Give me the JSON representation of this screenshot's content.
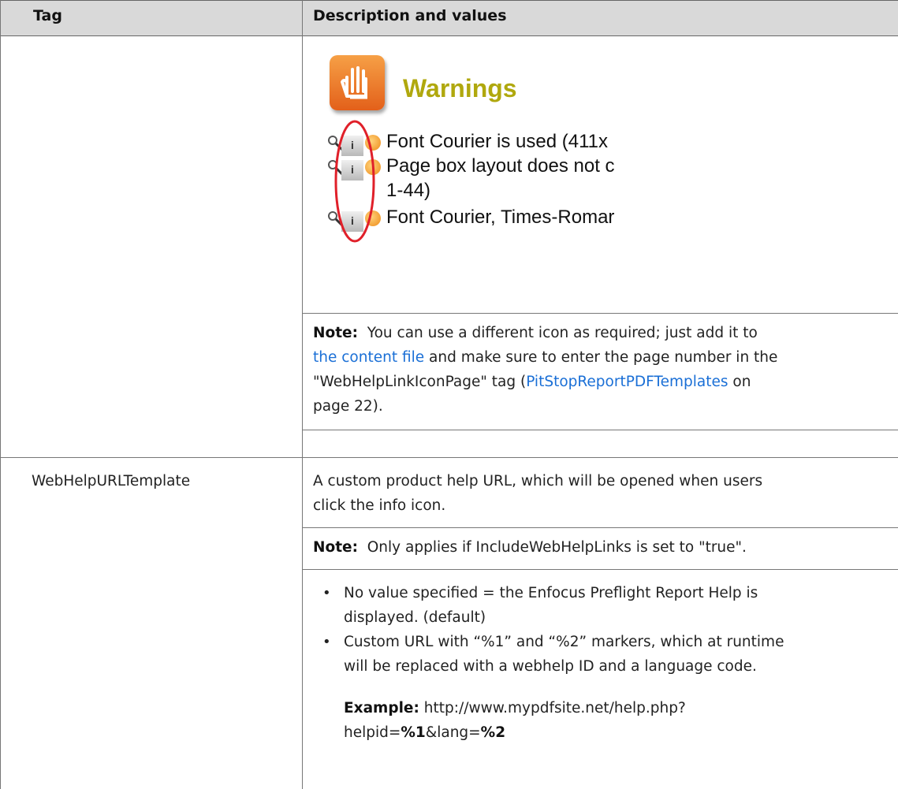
{
  "header": {
    "tag": "Tag",
    "description": "Description and values"
  },
  "screenshot": {
    "title": "Warnings",
    "rows": [
      {
        "text": "Font Courier is used (411x"
      },
      {
        "text": "Page box layout does not c"
      },
      {
        "text": "1-44)"
      },
      {
        "text": "Font Courier, Times-Romar"
      }
    ]
  },
  "note1": {
    "label": "Note:",
    "line1": "You can use a different icon as required; just add it to",
    "link": "the content file",
    "line2_rest": "and make sure to enter the page number in the",
    "line3_start": "\"WebHelpLinkIconPage\" tag (",
    "link2": "PitStopReportPDFTemplates",
    "line3_end": "on",
    "line4": "page 22)."
  },
  "row2": {
    "tag": "WebHelpURLTemplate",
    "desc_line1": "A custom product help URL, which will be opened when users",
    "desc_line2": "click the info icon.",
    "note_label": "Note:",
    "note_text": "Only applies if IncludeWebHelpLinks is set to \"true\".",
    "bullets": [
      {
        "line1": "No value specified = the Enfocus Preflight Report Help is",
        "line2": "displayed. (default)"
      },
      {
        "line1": "Custom URL with “%1” and “%2” markers, which at runtime",
        "line2": "will be replaced with a webhelp ID and a language code."
      }
    ],
    "example_label": "Example:",
    "example_url": "http://www.mypdfsite.net/help.php?",
    "example_line2_a": "helpid=",
    "example_p1": "%1",
    "example_line2_b": "&lang=",
    "example_p2": "%2"
  }
}
